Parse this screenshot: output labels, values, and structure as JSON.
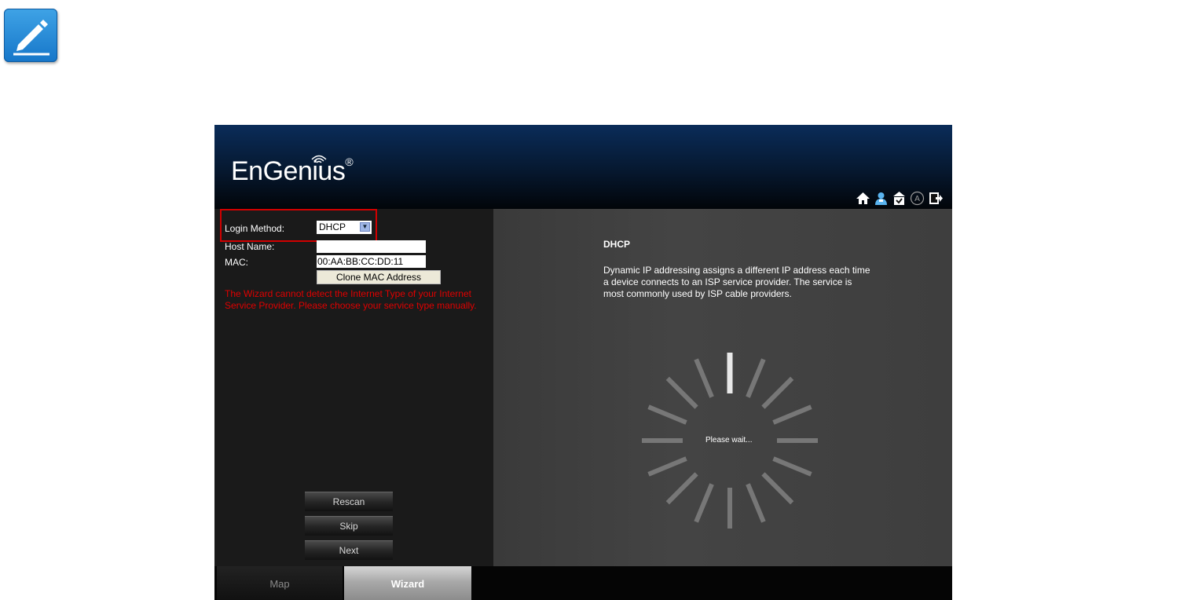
{
  "brand": {
    "logo_text": "EnGenius",
    "logo_mark": "®"
  },
  "header_icons": [
    "home-icon",
    "user-icon",
    "firmware-icon",
    "lock-icon",
    "logout-icon"
  ],
  "form": {
    "login_method_label": "Login Method:",
    "login_method_value": "DHCP",
    "host_name_label": "Host Name:",
    "host_name_value": "",
    "mac_label": "MAC:",
    "mac_value": "00:AA:BB:CC:DD:11",
    "clone_mac_button": "Clone MAC Address",
    "warning": "The Wizard cannot detect the Internet Type of your Internet Service Provider. Please choose your service type manually."
  },
  "actions": {
    "rescan": "Rescan",
    "skip": "Skip",
    "next": "Next"
  },
  "info": {
    "title": "DHCP",
    "description": "Dynamic IP addressing assigns a different IP address each time a device connects to an ISP service provider. The service is most commonly used by ISP cable providers.",
    "loading_text": "Please wait..."
  },
  "tabs": {
    "map": "Map",
    "wizard": "Wizard",
    "active": "Wizard"
  },
  "colors": {
    "warning": "#e00000",
    "highlight_border": "#d10000",
    "header_top": "#0a2c59"
  }
}
